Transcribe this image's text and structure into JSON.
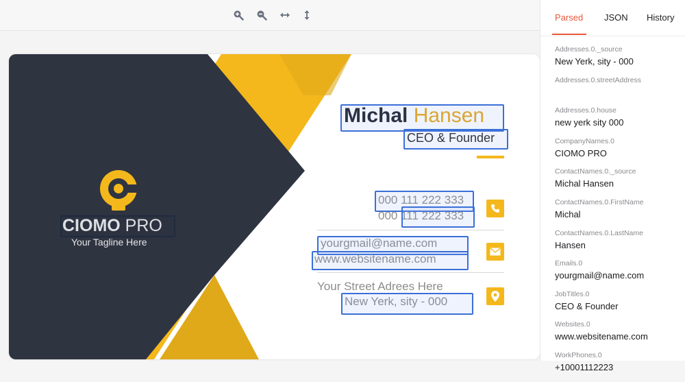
{
  "toolbar": {
    "icons": [
      "zoom-in-icon",
      "zoom-out-icon",
      "fit-width-icon",
      "fit-height-icon"
    ]
  },
  "card": {
    "colors": {
      "dark": "#2f3441",
      "yellow": "#f4b81c",
      "gold": "#e0a91a",
      "ocr_box": "#3a6fd8"
    },
    "company": {
      "part1": "CIOMO",
      "part2": " PRO",
      "tagline": "Your Tagline Here"
    },
    "name": {
      "first": "Michal",
      "last": " Hansen"
    },
    "title": "CEO & Founder",
    "phones": [
      "000 111 222 333",
      "000 111 222 333"
    ],
    "email": "yourgmail@name.com",
    "website": "www.websitename.com",
    "address_line1": "Your Street Adrees Here",
    "address_line2": "New Yerk, sity - 000"
  },
  "panel": {
    "tabs": [
      {
        "label": "Parsed",
        "active": true
      },
      {
        "label": "JSON",
        "active": false
      },
      {
        "label": "History",
        "active": false
      }
    ],
    "fields": [
      {
        "key": "Addresses.0._source",
        "value": "New Yerk, sity - 000"
      },
      {
        "key": "Addresses.0.streetAddress",
        "value": ""
      },
      {
        "key": "Addresses.0.house",
        "value": "new yerk sity 000"
      },
      {
        "key": "CompanyNames.0",
        "value": "CIOMO PRO"
      },
      {
        "key": "ContactNames.0._source",
        "value": "Michal Hansen"
      },
      {
        "key": "ContactNames.0.FirstName",
        "value": "Michal"
      },
      {
        "key": "ContactNames.0.LastName",
        "value": "Hansen"
      },
      {
        "key": "Emails.0",
        "value": "yourgmail@name.com"
      },
      {
        "key": "JobTitles.0",
        "value": "CEO & Founder"
      },
      {
        "key": "Websites.0",
        "value": "www.websitename.com"
      },
      {
        "key": "WorkPhones.0",
        "value": "+10001112223"
      }
    ]
  }
}
